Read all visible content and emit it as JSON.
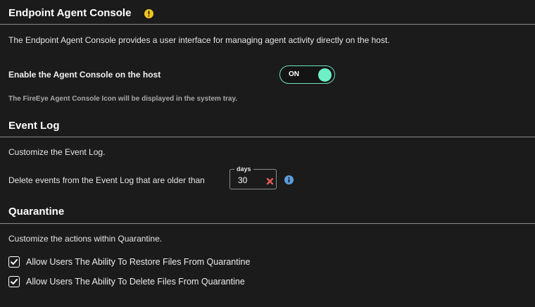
{
  "agent_console": {
    "title": "Endpoint Agent Console",
    "description": "The Endpoint Agent Console provides a user interface for managing agent activity directly on the host.",
    "enable_label": "Enable the Agent Console on the host",
    "toggle_state": "ON",
    "note": "The FireEye Agent Console Icon will be displayed in the system tray.",
    "warning_icon": "warning-icon"
  },
  "event_log": {
    "title": "Event Log",
    "description": "Customize the Event Log.",
    "delete_label": "Delete events from the Event Log that are older than",
    "days_caption": "days",
    "days_value": "30",
    "clear_icon": "clear-x-icon",
    "info_icon": "info-icon"
  },
  "quarantine": {
    "title": "Quarantine",
    "description": "Customize the actions within Quarantine.",
    "options": [
      {
        "label": "Allow Users The Ability To Restore Files From Quarantine",
        "checked": true
      },
      {
        "label": "Allow Users The Ability To Delete Files From Quarantine",
        "checked": true
      }
    ]
  },
  "colors": {
    "background": "#1b1b1b",
    "toggle_accent": "#6ef0c6",
    "warning": "#f2c51b",
    "info": "#5c9ee0",
    "clear": "#e05a55"
  }
}
